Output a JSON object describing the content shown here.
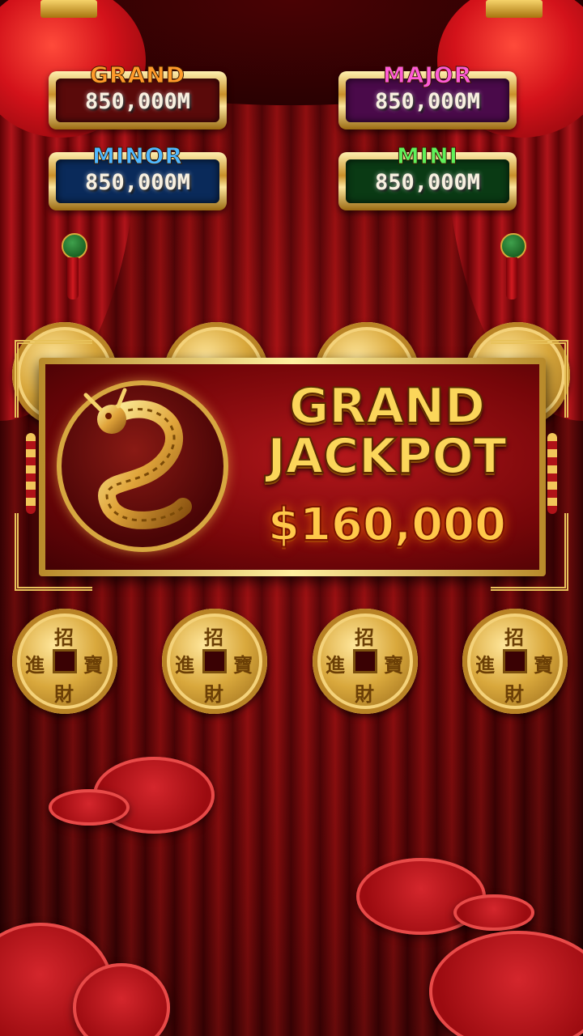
{
  "jackpots": {
    "grand": {
      "title": "GRAND",
      "value": "850,000M",
      "title_color": "#ff9a2a",
      "bg": "#5a0a0a"
    },
    "major": {
      "title": "MAJOR",
      "value": "850,000M",
      "title_color": "#ff5bd6",
      "bg": "#4a0a4a"
    },
    "minor": {
      "title": "MINOR",
      "value": "850,000M",
      "title_color": "#4fb8ff",
      "bg": "#0a2a5a"
    },
    "mini": {
      "title": "MINI",
      "value": "850,000M",
      "title_color": "#5ff05a",
      "bg": "#0a3a14"
    }
  },
  "panel": {
    "headline_line1": "GRAND",
    "headline_line2": "JACKPOT",
    "amount": "$160,000"
  },
  "coin_characters": {
    "top": "招",
    "left": "進",
    "right": "寶",
    "bottom": "財"
  },
  "colors": {
    "curtain": "#a60d12",
    "gold": "#e8c25a"
  }
}
